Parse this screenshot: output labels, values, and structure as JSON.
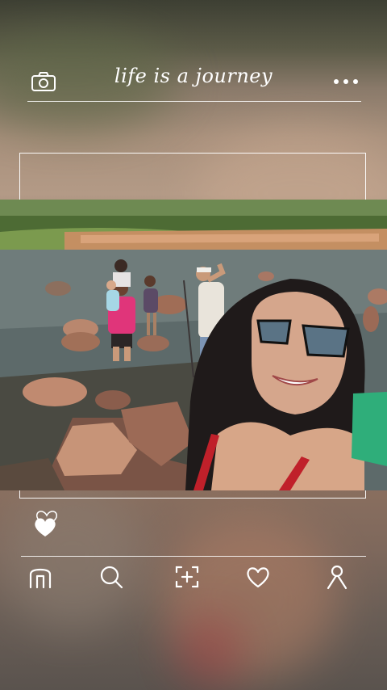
{
  "header": {
    "title": "life is a journey",
    "camera_icon": "camera-icon",
    "more_icon": "more-dots-icon"
  },
  "post": {
    "photo_description_icon": "group-selfie-photo",
    "like_icon": "heart-icon"
  },
  "bottom_nav": {
    "items": [
      {
        "icon": "home-icon"
      },
      {
        "icon": "search-icon"
      },
      {
        "icon": "add-post-icon"
      },
      {
        "icon": "heart-icon"
      },
      {
        "icon": "profile-icon"
      }
    ]
  },
  "colors": {
    "foreground": "#ffffff",
    "line": "#ffffff"
  }
}
